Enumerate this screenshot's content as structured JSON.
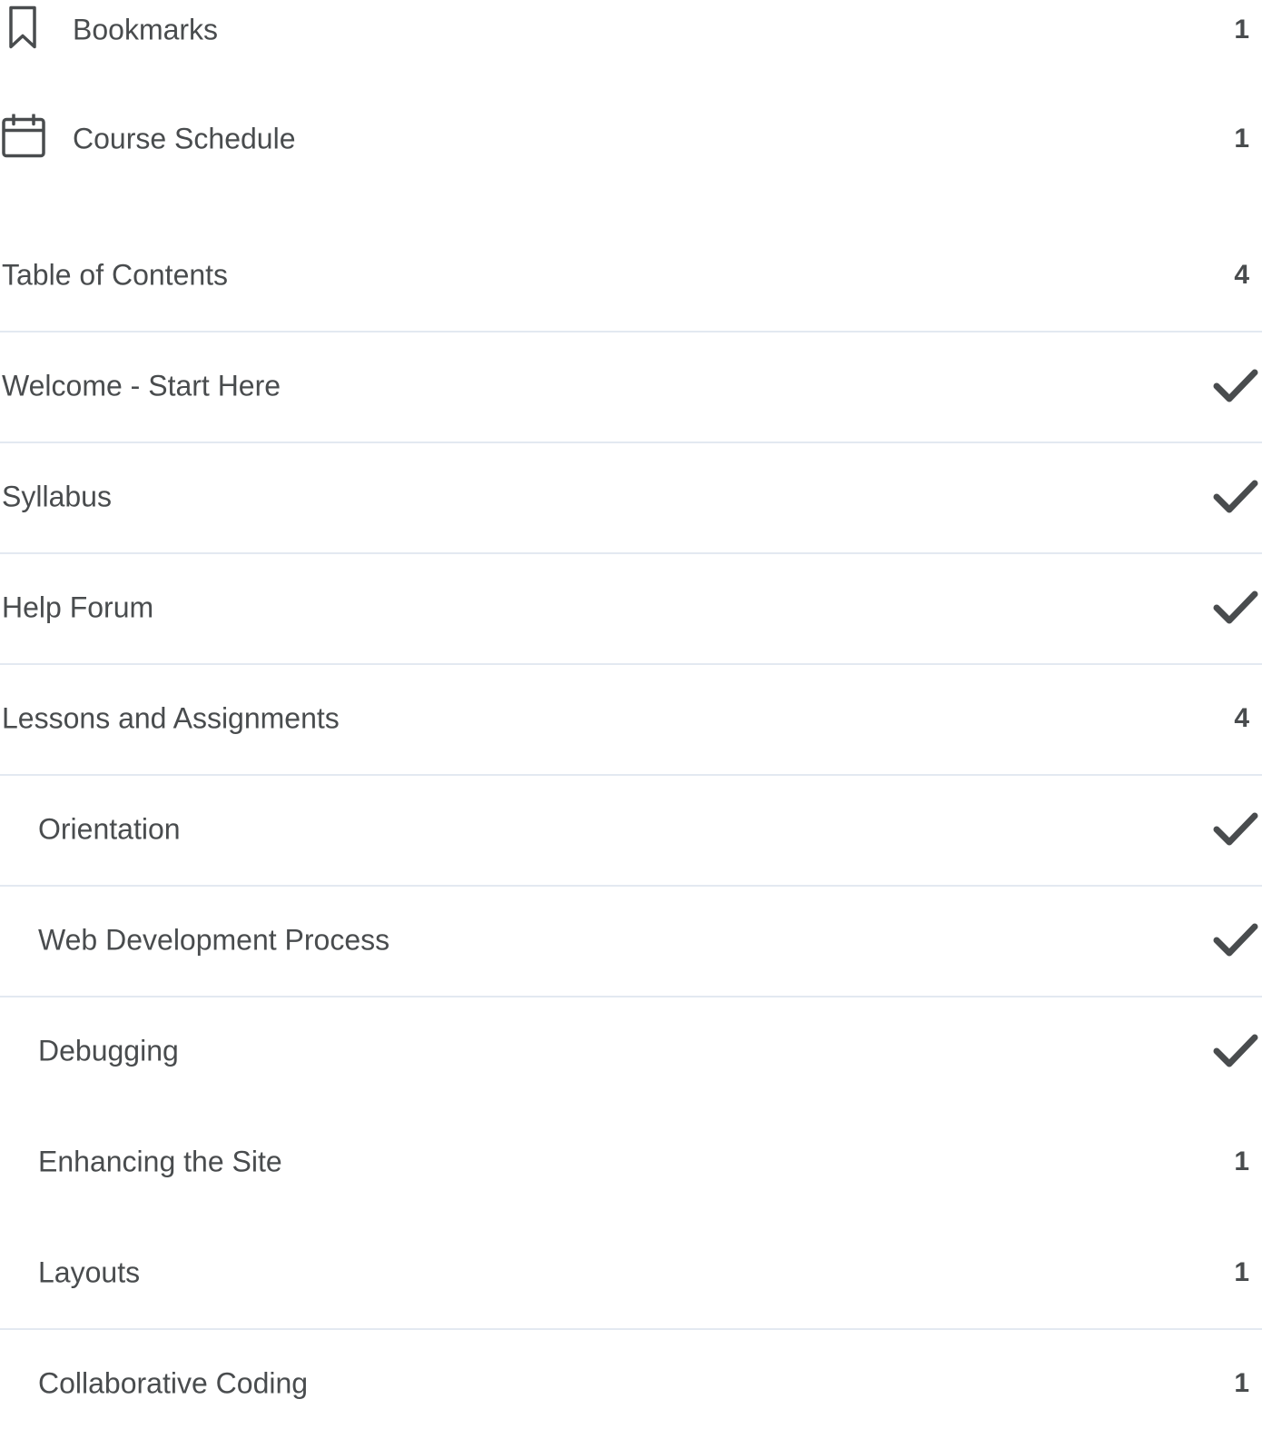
{
  "quick_links": [
    {
      "label": "Bookmarks",
      "count": "1",
      "icon": "bookmark-icon"
    },
    {
      "label": "Course Schedule",
      "count": "1",
      "icon": "calendar-icon"
    }
  ],
  "toc": {
    "label": "Table of Contents",
    "count": "4"
  },
  "modules": [
    {
      "label": "Welcome - Start Here",
      "status": "complete"
    },
    {
      "label": "Syllabus",
      "status": "complete"
    },
    {
      "label": "Help Forum",
      "status": "complete"
    },
    {
      "label": "Lessons and Assignments",
      "count": "4"
    }
  ],
  "submodules": [
    {
      "label": "Orientation",
      "status": "complete"
    },
    {
      "label": "Web Development Process",
      "status": "complete"
    },
    {
      "label": "Debugging",
      "status": "complete"
    },
    {
      "label": "Enhancing the Site",
      "count": "1"
    },
    {
      "label": "Layouts",
      "count": "1"
    },
    {
      "label": "Collaborative Coding",
      "count": "1"
    }
  ],
  "colors": {
    "text": "#494c4e",
    "divider": "#e3e9f1",
    "background": "#ffffff"
  }
}
